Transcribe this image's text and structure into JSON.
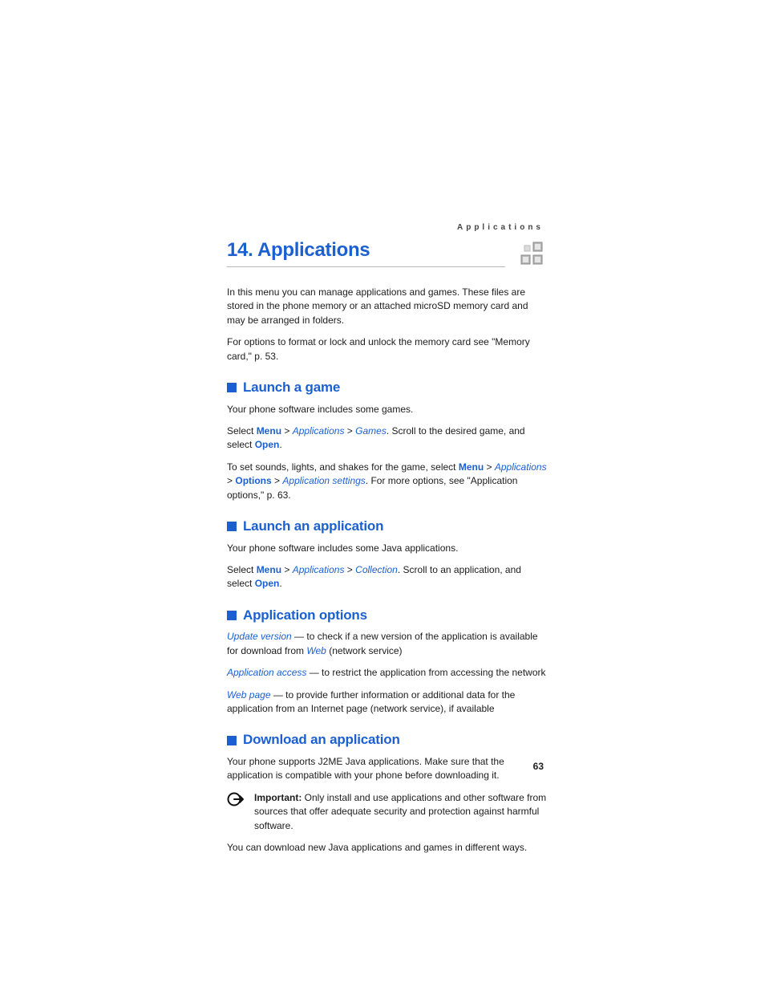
{
  "running_head": "Applications",
  "chapter_title": "14. Applications",
  "intro_p1": "In this menu you can manage applications and games. These files are stored in the phone memory or an attached microSD memory card and may be arranged in folders.",
  "intro_p2": "For options to format or lock and unlock the memory card see \"Memory card,\" p. 53.",
  "s1": {
    "title": "Launch a game",
    "p1": "Your phone software includes some games.",
    "p2_a": "Select ",
    "menu": "Menu",
    "gt": ">",
    "applications": "Applications",
    "games": "Games",
    "p2_b": ". Scroll to the desired game, and select ",
    "open": "Open",
    "period": ".",
    "p3_a": "To set sounds, lights, and shakes for the game, select ",
    "options": "Options",
    "appsettings": "Application settings",
    "p3_b": ". For more options, see \"Application options,\" p. 63."
  },
  "s2": {
    "title": "Launch an application",
    "p1": "Your phone software includes some Java applications.",
    "p2_a": "Select ",
    "collection": "Collection",
    "p2_b": ". Scroll to an application, and select "
  },
  "s3": {
    "title": "Application options",
    "updver": "Update version",
    "up_b": " — to check if a new version of the application is available for download from ",
    "web": "Web",
    "up_c": " (network service)",
    "appaccess": "Application access",
    "aa_b": " — to restrict the application from accessing the network",
    "webpage": "Web page",
    "wp_b": " — to provide further information or additional data for the application from an Internet page (network service), if available"
  },
  "s4": {
    "title": "Download an application",
    "p1": "Your phone supports J2ME Java applications. Make sure that the application is compatible with your phone before downloading it.",
    "important_label": "Important:",
    "important_body": " Only install and use applications and other software from sources that offer adequate security and protection against harmful software.",
    "p2": "You can download new Java applications and games in different ways."
  },
  "page_number": "63"
}
